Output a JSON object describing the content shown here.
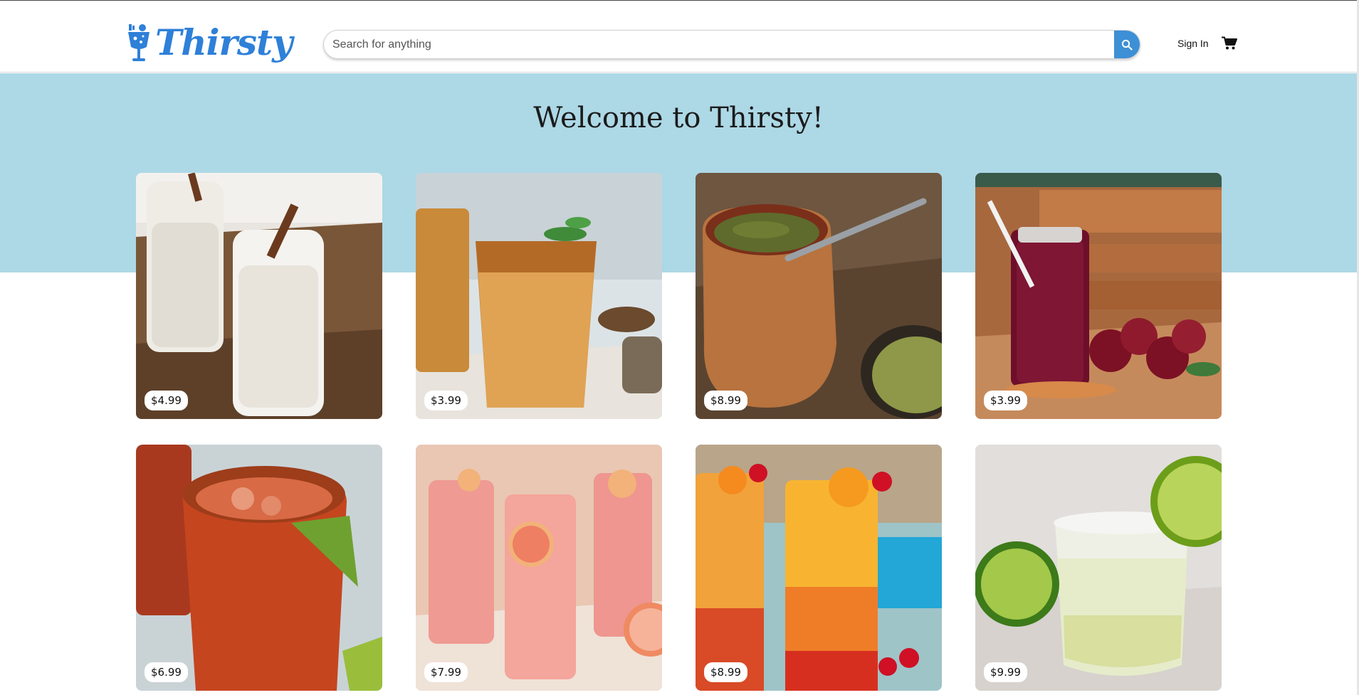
{
  "header": {
    "brand": "Thirsty",
    "search": {
      "placeholder": "Search for anything",
      "value": ""
    },
    "sign_in": "Sign In",
    "icons": {
      "logo": "cocktail-glass-icon",
      "search": "search-icon",
      "cart": "cart-icon"
    }
  },
  "hero": {
    "title": "Welcome to Thirsty!",
    "background": "#add8e6"
  },
  "colors": {
    "brand": "#2e80d8",
    "search_button": "#3d8fd6"
  },
  "products": [
    {
      "price": "$4.99",
      "image": "horchata-photo"
    },
    {
      "price": "$3.99",
      "image": "iced-coffee-photo"
    },
    {
      "price": "$8.99",
      "image": "yerba-mate-photo"
    },
    {
      "price": "$3.99",
      "image": "hibiscus-drink-photo"
    },
    {
      "price": "$6.99",
      "image": "michelada-photo"
    },
    {
      "price": "$7.99",
      "image": "grapefruit-drink-photo"
    },
    {
      "price": "$8.99",
      "image": "sunrise-cocktail-photo"
    },
    {
      "price": "$9.99",
      "image": "margarita-photo"
    }
  ]
}
